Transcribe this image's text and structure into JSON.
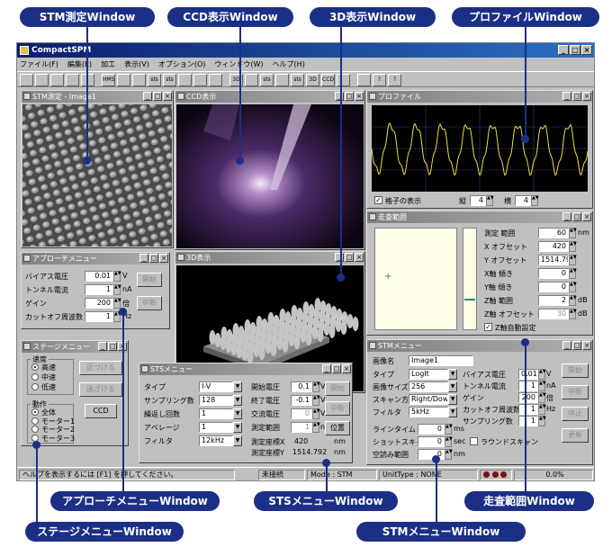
{
  "callouts": {
    "stm_measure": "STM測定Window",
    "ccd": "CCD表示Window",
    "view3d": "3D表示Window",
    "profile": "プロファイルWindow",
    "approach": "アプローチメニューWindow",
    "sts": "STSメニューWindow",
    "scan_range": "走査範囲Window",
    "stage": "ステージメニューWindow",
    "stm_menu": "STMメニューWindow"
  },
  "app": {
    "title": "CompactSPM",
    "menu": [
      "ファイル(F)",
      "編集(E)",
      "加工",
      "表示(V)",
      "オプション(O)",
      "ウィンドウ(W)",
      "ヘルプ(H)"
    ],
    "toolbar": [
      "",
      "",
      "",
      "",
      "",
      "HMS",
      "",
      "",
      "sts",
      "sts",
      "",
      "",
      "",
      "3D",
      "",
      "sts",
      "",
      "sts",
      "3D",
      "CCD",
      "",
      "",
      "?",
      "?"
    ]
  },
  "stm_win": {
    "title": "STM測定 - Image1"
  },
  "ccd_win": {
    "title": "CCD表示"
  },
  "win3d": {
    "title": "3D表示",
    "axis_tick": "16.80"
  },
  "profile_win": {
    "title": "プロファイル",
    "grid_label": "格子の表示",
    "vert_label": "縦",
    "vert_value": "4",
    "horiz_label": "横",
    "horiz_value": "4",
    "trace_color": "#e8e03a"
  },
  "scan_win": {
    "title": "走査範囲",
    "rows": [
      {
        "label": "測定 範囲",
        "value": "60",
        "unit": "nm",
        "disabled": false
      },
      {
        "label": "X オフセット",
        "value": "420",
        "unit": "",
        "disabled": false
      },
      {
        "label": "Y オフセット",
        "value": "1514.792",
        "unit": "",
        "disabled": false
      },
      {
        "label": "X軸 傾き",
        "value": "0",
        "unit": "",
        "disabled": false
      },
      {
        "label": "Y軸 傾き",
        "value": "0",
        "unit": "",
        "disabled": false
      },
      {
        "label": "Z軸 範囲",
        "value": "2",
        "unit": "dB",
        "disabled": false
      },
      {
        "label": "Z軸 オフセット",
        "value": "30",
        "unit": "dB",
        "disabled": true
      }
    ],
    "auto_label": "Z軸自動設定"
  },
  "approach_win": {
    "title": "アプローチメニュー",
    "rows": [
      {
        "label": "バイアス電圧",
        "value": "0.01",
        "unit": "V"
      },
      {
        "label": "トンネル電流",
        "value": "1",
        "unit": "nA"
      },
      {
        "label": "ゲイン",
        "value": "200",
        "unit": "倍"
      },
      {
        "label": "カットオフ周波数",
        "value": "1",
        "unit": "Hz"
      }
    ],
    "start": "開始",
    "stop": "中断"
  },
  "stage_win": {
    "title": "ステージメニュー",
    "speed_label": "速度",
    "speeds": [
      "高速",
      "中速",
      "低速"
    ],
    "action_label": "動作",
    "actions": [
      "全体",
      "モーター1",
      "モーター2",
      "モーター3"
    ],
    "near": "近づける",
    "far": "遠ざける",
    "ccd": "CCD"
  },
  "sts_win": {
    "title": "STSメニュー",
    "left_rows": [
      {
        "label": "タイプ",
        "value": "I-V"
      },
      {
        "label": "サンプリング数",
        "value": "128"
      },
      {
        "label": "繰返し回数",
        "value": "1"
      },
      {
        "label": "アベレージ",
        "value": "1"
      },
      {
        "label": "フィルタ",
        "value": "12kHz"
      }
    ],
    "right_rows": [
      {
        "label": "開始電圧",
        "value": "0.1",
        "unit": "V",
        "disabled": false
      },
      {
        "label": "終了電圧",
        "value": "-0.1",
        "unit": "V",
        "disabled": false
      },
      {
        "label": "交流電圧",
        "value": "0",
        "unit": "V",
        "disabled": true
      },
      {
        "label": "測定範囲",
        "value": "1",
        "unit": "nm",
        "disabled": true
      }
    ],
    "coord_x_label": "測定座標X",
    "coord_x_value": "420",
    "coord_y_label": "測定座標Y",
    "coord_y_value": "1514.792",
    "coord_unit": "nm",
    "start": "開始",
    "stop": "中断",
    "position": "位置"
  },
  "stm_menu_win": {
    "title": "STMメニュー",
    "image_name_label": "画像名",
    "image_name": "Image1",
    "left_rows": [
      {
        "label": "タイプ",
        "value": "LogIt"
      },
      {
        "label": "画像サイズ",
        "value": "256"
      },
      {
        "label": "スキャン方向",
        "value": "Right/Down"
      },
      {
        "label": "フィルタ",
        "value": "5kHz"
      }
    ],
    "mid_rows": [
      {
        "label": "バイアス電圧",
        "value": "0.01",
        "unit": "V"
      },
      {
        "label": "トンネル電流",
        "value": "1",
        "unit": "nA"
      },
      {
        "label": "ゲイン",
        "value": "200",
        "unit": "倍"
      },
      {
        "label": "カットオフ周波数",
        "value": "1",
        "unit": "Hz"
      },
      {
        "label": "サンプリング数",
        "value": "1",
        "unit": ""
      }
    ],
    "line_time_label": "ラインタイム",
    "line_time": "0",
    "line_time_unit": "ms",
    "shot_label": "ショットスキャン",
    "shot": "0",
    "shot_unit": "sec",
    "countdown_label": "ラウンドスキャン",
    "gap_label": "空読み範囲",
    "gap": "0",
    "gap_unit": "nm",
    "start": "開始",
    "stop": "中断",
    "halt": "停止",
    "update": "更新"
  },
  "statusbar": {
    "help": "ヘルプを表示するには [F1] を押してください。",
    "conn": "未接続",
    "mode": "Mode : STM",
    "unit": "UnitType : NONE",
    "percent": "0.0%"
  }
}
